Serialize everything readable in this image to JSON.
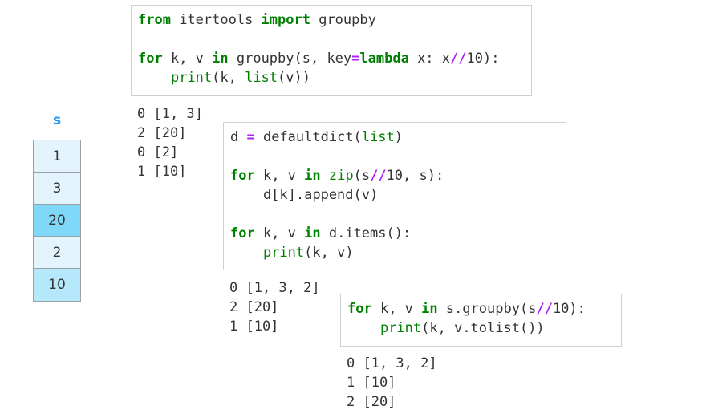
{
  "series": {
    "header": "s",
    "values": [
      "1",
      "3",
      "20",
      "2",
      "10"
    ],
    "highlight_color": "#7fd8f8",
    "last_color": "#b6e8fb"
  },
  "colors": {
    "keyword": "#008000",
    "operator": "#aa22ff",
    "header": "#2196f3"
  },
  "blocks": [
    {
      "id": "block1",
      "code": [
        [
          [
            "kw",
            "from"
          ],
          [
            "t",
            " itertools "
          ],
          [
            "kw",
            "import"
          ],
          [
            "t",
            " groupby"
          ]
        ],
        [],
        [
          [
            "kw",
            "for"
          ],
          [
            "t",
            " k, v "
          ],
          [
            "kw",
            "in"
          ],
          [
            "t",
            " groupby(s, key"
          ],
          [
            "op",
            "="
          ],
          [
            "kw",
            "lambda"
          ],
          [
            "t",
            " x: x"
          ],
          [
            "op",
            "//"
          ],
          [
            "t",
            "10):"
          ]
        ],
        [
          [
            "t",
            "    "
          ],
          [
            "bi",
            "print"
          ],
          [
            "t",
            "(k, "
          ],
          [
            "bi",
            "list"
          ],
          [
            "t",
            "(v))"
          ]
        ]
      ],
      "output": [
        "0 [1, 3]",
        "2 [20]",
        "0 [2]",
        "1 [10]"
      ]
    },
    {
      "id": "block2",
      "code": [
        [
          [
            "t",
            "d "
          ],
          [
            "op",
            "="
          ],
          [
            "t",
            " defaultdict("
          ],
          [
            "bi",
            "list"
          ],
          [
            "t",
            ")"
          ]
        ],
        [],
        [
          [
            "kw",
            "for"
          ],
          [
            "t",
            " k, v "
          ],
          [
            "kw",
            "in"
          ],
          [
            "t",
            " "
          ],
          [
            "bi",
            "zip"
          ],
          [
            "t",
            "(s"
          ],
          [
            "op",
            "//"
          ],
          [
            "t",
            "10, s):"
          ]
        ],
        [
          [
            "t",
            "    d[k].append(v)"
          ]
        ],
        [],
        [
          [
            "kw",
            "for"
          ],
          [
            "t",
            " k, v "
          ],
          [
            "kw",
            "in"
          ],
          [
            "t",
            " d.items():"
          ]
        ],
        [
          [
            "t",
            "    "
          ],
          [
            "bi",
            "print"
          ],
          [
            "t",
            "(k, v)"
          ]
        ]
      ],
      "output": [
        "0 [1, 3, 2]",
        "2 [20]",
        "1 [10]"
      ]
    },
    {
      "id": "block3",
      "code": [
        [
          [
            "kw",
            "for"
          ],
          [
            "t",
            " k, v "
          ],
          [
            "kw",
            "in"
          ],
          [
            "t",
            " s.groupby(s"
          ],
          [
            "op",
            "//"
          ],
          [
            "t",
            "10):"
          ]
        ],
        [
          [
            "t",
            "    "
          ],
          [
            "bi",
            "print"
          ],
          [
            "t",
            "(k, v.tolist())"
          ]
        ]
      ],
      "output": [
        "0 [1, 3, 2]",
        "1 [10]",
        "2 [20]"
      ]
    }
  ]
}
